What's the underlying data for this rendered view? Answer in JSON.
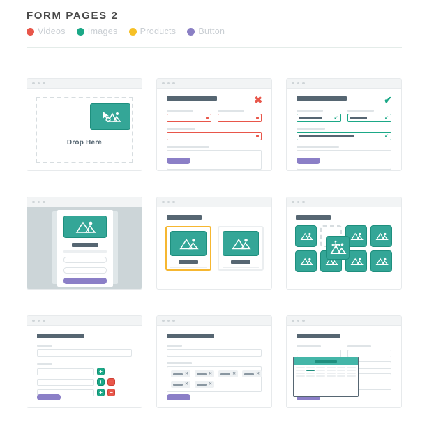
{
  "header": {
    "title": "FORM PAGES 2",
    "legend": [
      {
        "label": "Videos",
        "color": "#e8564a",
        "icon": "legend-dot-videos"
      },
      {
        "label": "Images",
        "color": "#1ba887",
        "icon": "legend-dot-images"
      },
      {
        "label": "Products",
        "color": "#f6c026",
        "icon": "legend-dot-products"
      },
      {
        "label": "Button",
        "color": "#8a7fc4",
        "icon": "legend-dot-button"
      }
    ]
  },
  "palette": {
    "teal": "#34a697",
    "teal_dark": "#1e8f7e",
    "red": "#e8564a",
    "yellow": "#f6b731",
    "purple": "#8b7fc7",
    "slate": "#566672",
    "border": "#e7eaec"
  },
  "cards": {
    "drop_zone": {
      "name": "drop-zone-upload",
      "drop_text": "Drop Here",
      "tile_icon": "image-add-cursor-icon"
    },
    "form_error": {
      "name": "form-validation-error",
      "status_icon": "error-cross-icon",
      "status_symbol": "✖",
      "fields": 3,
      "error_marker": "error-dot"
    },
    "form_success": {
      "name": "form-validation-success",
      "status_icon": "success-check-icon",
      "status_symbol": "✔",
      "fields": 3,
      "ok_marker": "✔"
    },
    "modal_upload": {
      "name": "modal-image-dialog",
      "image_icon": "image-icon"
    },
    "image_picker": {
      "name": "image-picker",
      "items": 2,
      "selected_index": 0
    },
    "drag_grid": {
      "name": "image-drag-grid",
      "tiles": 7,
      "empty_slots": 1,
      "drag_icon": "move-cursor-icon"
    },
    "repeater": {
      "name": "repeatable-fields",
      "rows": 3,
      "add_symbol": "+",
      "remove_symbol": "−"
    },
    "tag_input": {
      "name": "tag-token-input",
      "tags_row1": 4,
      "tags_row2": 2,
      "chip_remove_symbol": "✕"
    },
    "date_picker": {
      "name": "date-picker-calendar",
      "weeks": 4,
      "days_per_week": 6,
      "selected_cell": 7
    }
  }
}
